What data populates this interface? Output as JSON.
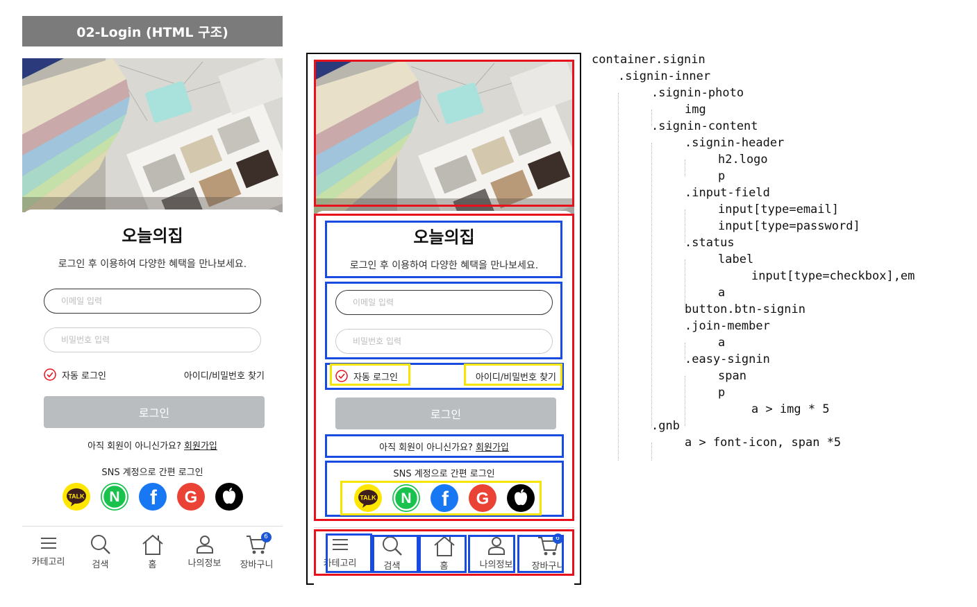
{
  "header": {
    "title": "02-Login (HTML 구조)"
  },
  "signin": {
    "logo": "오늘의집",
    "subtitle": "로그인 후 이용하여 다양한 혜택을 만나보세요.",
    "email_placeholder": "이메일 입력",
    "password_placeholder": "비밀번호 입력",
    "auto_login": "자동 로그인",
    "find_account": "아이디/비밀번호 찾기",
    "login_button": "로그인",
    "join_prompt": "아직 회원이 아니신가요?",
    "join_link": "회원가입",
    "sns_title": "SNS 계정으로 간편 로그인",
    "sns": [
      {
        "name": "kakao",
        "label": "TALK",
        "color": "#ffe600"
      },
      {
        "name": "naver",
        "label": "N",
        "color": "#19c24d"
      },
      {
        "name": "facebook",
        "label": "f",
        "color": "#1877f2"
      },
      {
        "name": "google",
        "label": "G",
        "color": "#ea4335"
      },
      {
        "name": "apple",
        "label": "",
        "color": "#000000"
      }
    ]
  },
  "gnb": {
    "items": [
      {
        "label": "카테고리",
        "icon": "menu-icon"
      },
      {
        "label": "검색",
        "icon": "search-icon"
      },
      {
        "label": "홈",
        "icon": "home-icon"
      },
      {
        "label": "나의정보",
        "icon": "user-icon"
      },
      {
        "label": "장바구니",
        "icon": "cart-icon",
        "badge": "6"
      }
    ]
  },
  "code_tree": [
    "container.signin",
    ".signin-inner",
    ".signin-photo",
    "img",
    ".signin-content",
    ".signin-header",
    "h2.logo",
    "p",
    ".input-field",
    "input[type=email]",
    "input[type=password]",
    ".status",
    "label",
    "input[type=checkbox],em",
    "a",
    "button.btn-signin",
    ".join-member",
    "a",
    ".easy-signin",
    "span",
    "p",
    "a > img * 5",
    ".gnb",
    "a > font-icon, span *5"
  ],
  "colors": {
    "annotation_red": "#e8101a",
    "annotation_blue": "#1a4be0",
    "annotation_yellow": "#f5e500",
    "button_gray": "#b9bdbf",
    "badge_blue": "#1a56d6",
    "check_red": "#e8101a"
  }
}
